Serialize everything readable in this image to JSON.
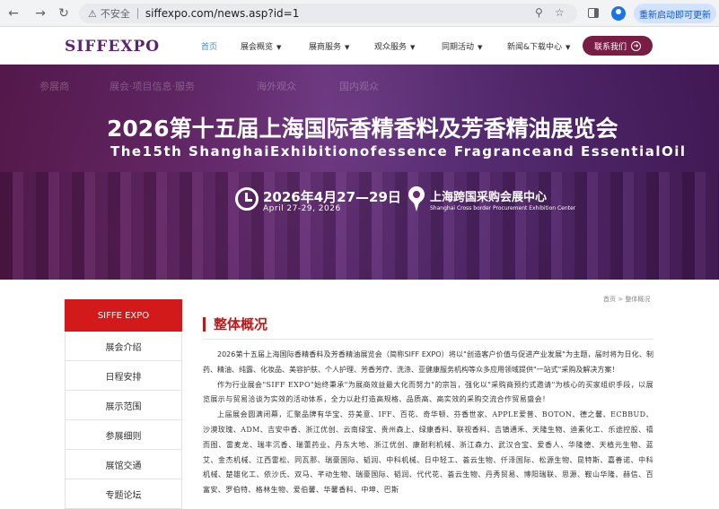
{
  "browser": {
    "security_label": "不安全",
    "url": "siffexpo.com/news.asp?id=1",
    "relaunch_label": "重新启动即可更新"
  },
  "header": {
    "logo": "SIFFEXPO",
    "nav": [
      {
        "label": "首页",
        "active": true,
        "dropdown": false
      },
      {
        "label": "展会概览",
        "active": false,
        "dropdown": true
      },
      {
        "label": "展商服务",
        "active": false,
        "dropdown": true
      },
      {
        "label": "观众服务",
        "active": false,
        "dropdown": true
      },
      {
        "label": "同期活动",
        "active": false,
        "dropdown": true
      },
      {
        "label": "新闻&下载中心",
        "active": false,
        "dropdown": true
      }
    ],
    "contact_label": "联系我们"
  },
  "banner": {
    "ghost_tabs": [
      "参展商",
      "展会·项目信息·服务",
      "海外观众",
      "国内观众"
    ],
    "title": "2026第十五届上海国际香精香料及芳香精油展览会",
    "subtitle": "The15th ShanghaiExhibitionofessence Fragranceand EssentialOil",
    "date": "2026年4月27—29日",
    "date_en": "April 27-29, 2026",
    "venue": "上海跨国采购会展中心",
    "venue_en": "Shanghai Cross border Procurement Exhibition Center"
  },
  "sidebar": {
    "head": "SIFFE EXPO",
    "items": [
      "展会介绍",
      "日程安排",
      "展示范围",
      "参展细则",
      "展馆交通",
      "专题论坛"
    ]
  },
  "main": {
    "breadcrumb": "首页 > 整体概况",
    "title": "整体概况",
    "paragraphs": [
      "2026第十五届上海国际香精香料及芳香精油展览会（简称SIFF EXPO）将以\"创造客户价值与促进产业发展\"为主题，届时将为日化、制药、精油、纯露、化妆品、美容护肤、个人护理、芳香芳疗、洗涤、亚健康服务机构等众多应用领域提供\"一站式\"采购及解决方案！",
      "作为行业展会\"SIFF EXPO\"始终秉承\"为展商效益最大化而努力\"的宗旨，强化以\"采购商预约式邀请\"为核心的买家组织手段，以展览展示与贸易洽谈为实效的活动体系，全力以赴打造高规格、品质高、高实效的采购交流合作贸易盛会！",
      "上届展会圆满闭幕，汇聚品牌有华宝、芬美意、IFF、百花、奇华顿、芬香世家、APPLE爱普、BOTON、德之馨、ECBBUD、沙漠玫瑰、ADM、吉安中香、浙江优创、云南绿宝、贵州森上、绿康香料、联视香料、吉镇通禾、天隆生物、迪素化工、乐途控股、禧而图、雷麦龙、瑞丰沉香、瑞蕾药业、丹东大地、浙江优创、康耐利机械、浙江森力、武汉合宝、爱香人、华隆德、天植元生物、蓝艾、金杰机械、江西雷松、同瓦那、瑞豪国际、韬润、中科机械、日中轻工、荟云生物、仟泽国际、松源生物、昆特斯、嘉善诺、中科机械、楚雄化工、依沙氏、双马、芊动生物、瑞豪国际、韬润、代代花、荟云生物、丹秀贸易、博阳瑞联、思源、鞍山华隆、赫信、百富安、罗伯特、格林生物、爱伯馨、华馨香料、中坤、巴斯"
    ]
  }
}
